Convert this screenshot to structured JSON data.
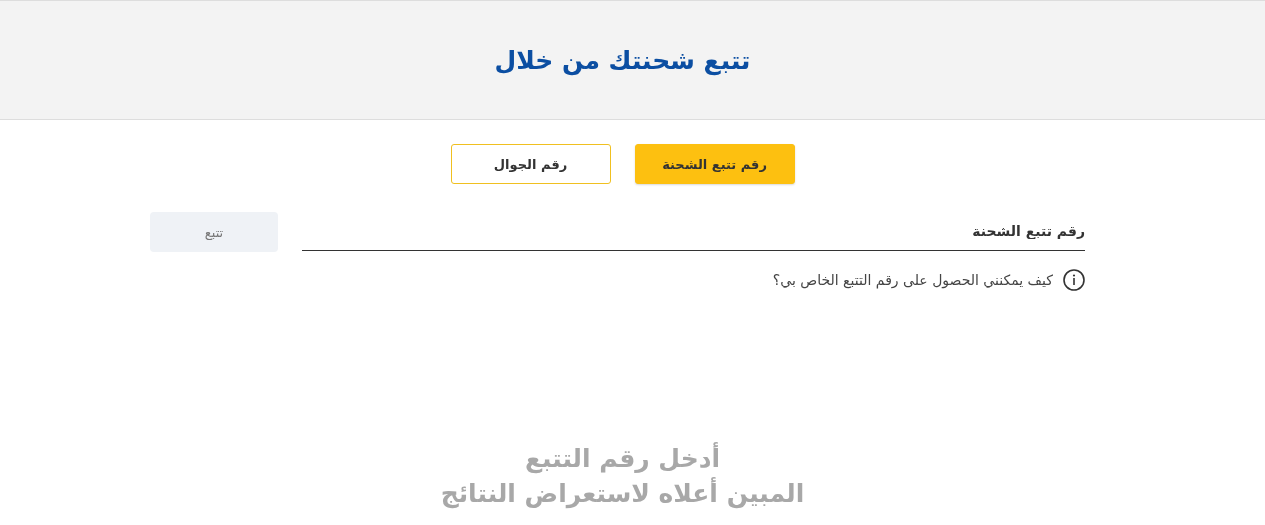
{
  "header": {
    "title": "تتبع شحنتك من خلال"
  },
  "tabs": [
    {
      "label": "رقم تتبع الشحنة",
      "selected": true
    },
    {
      "label": "رقم الجوال",
      "selected": false
    }
  ],
  "search": {
    "placeholder": "رقم تتبع الشحنة",
    "button": "تتبع",
    "button_disabled": true
  },
  "help_link": "كيف يمكنني الحصول على رقم التتبع الخاص بي؟",
  "empty_state": {
    "lines": [
      "أدخل رقم التتبع",
      "المبين أعلاه لاستعراض النتائج"
    ]
  }
}
